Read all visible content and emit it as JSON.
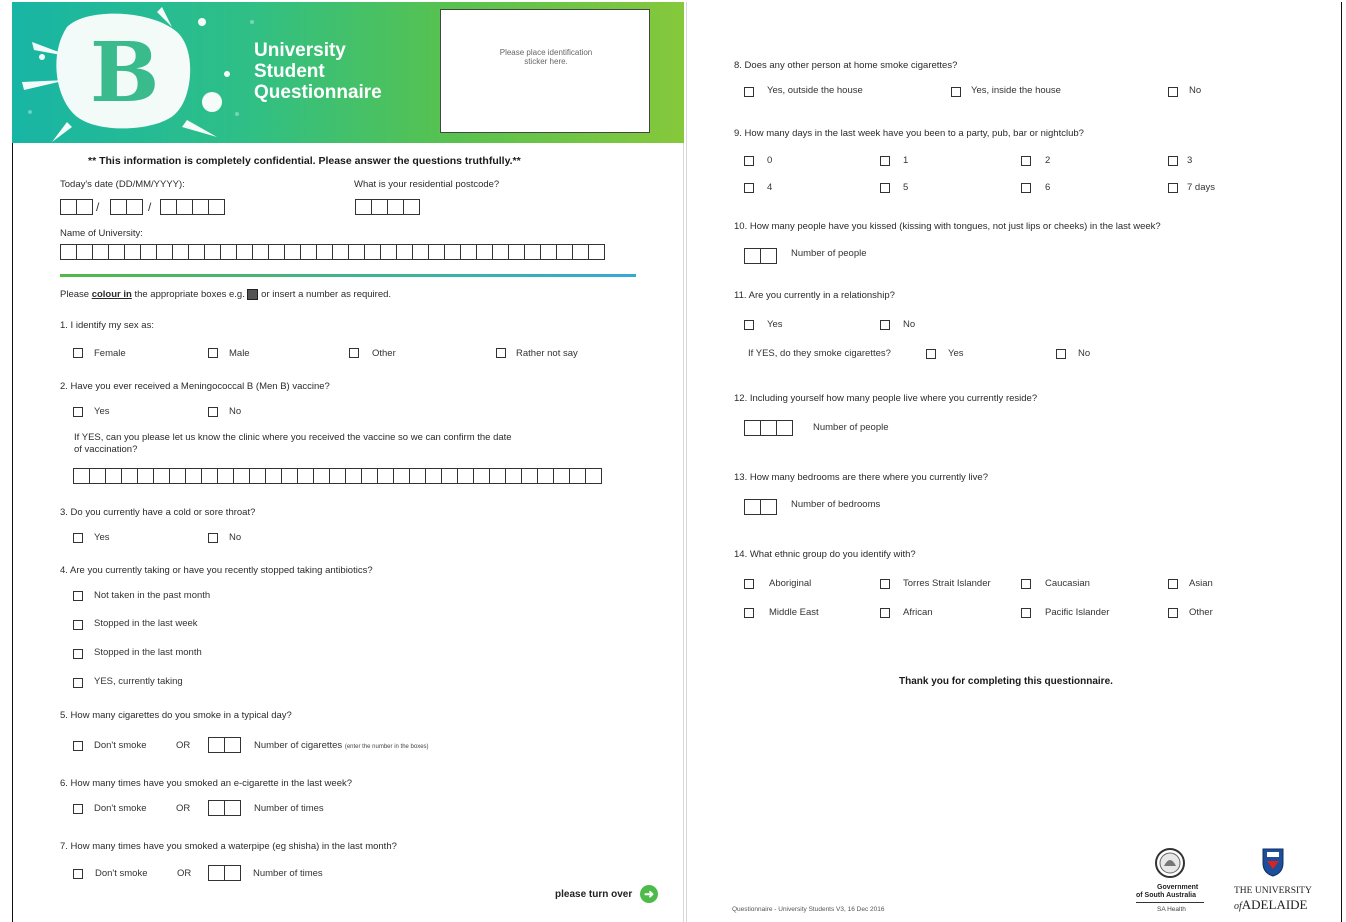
{
  "header": {
    "title_line1": "University",
    "title_line2": "Student",
    "title_line3": "Questionnaire",
    "logo_letter": "B",
    "sticker_text": "Please place identification sticker here."
  },
  "confidential": "** This information is completely confidential. Please answer the questions truthfully.**",
  "fields": {
    "date_label": "Today's date (DD/MM/YYYY):",
    "postcode_label": "What is your residential postcode?",
    "university_label": "Name of University:"
  },
  "instructions": {
    "prefix": "Please ",
    "emph": "colour in",
    "middle": " the appropriate boxes e.g. ",
    "suffix": " or insert a number as required."
  },
  "q1": {
    "text": "1.  I identify my sex as:",
    "options": [
      "Female",
      "Male",
      "Other",
      "Rather not say"
    ]
  },
  "q2": {
    "text": "2.  Have you ever received a Meningococcal B (Men B) vaccine?",
    "options": [
      "Yes",
      "No"
    ],
    "followup": "If YES, can you please let us know the clinic where you received the vaccine so we can confirm the date",
    "followup2": "of vaccination?"
  },
  "q3": {
    "text": "3.  Do you currently have a cold or sore throat?",
    "options": [
      "Yes",
      "No"
    ]
  },
  "q4": {
    "text": "4.  Are you currently taking or have you recently stopped taking antibiotics?",
    "options": [
      "Not taken in the past month",
      "Stopped in the last week",
      "Stopped in the last month",
      "YES, currently taking"
    ]
  },
  "q5": {
    "text": "5.  How many cigarettes do you smoke in a typical day?",
    "dont_smoke": "Don't smoke",
    "or": "OR",
    "count_label": "Number of cigarettes",
    "count_note": "(enter the number in the boxes)"
  },
  "q6": {
    "text": "6.  How many times have you smoked an e-cigarette in the last week?",
    "dont_smoke": "Don't smoke",
    "or": "OR",
    "count_label": "Number of times"
  },
  "q7": {
    "text": "7.  How many times have you smoked a waterpipe (eg shisha) in the last month?",
    "dont_smoke": "Don't smoke",
    "or": "OR",
    "count_label": "Number of times"
  },
  "turn_over": "please turn over",
  "q8": {
    "text": "8.  Does any other person at home smoke cigarettes?",
    "options": [
      "Yes, outside the house",
      "Yes, inside the house",
      "No"
    ]
  },
  "q9": {
    "text": "9.  How many days in the last week have you been to a party, pub, bar or nightclub?",
    "options": [
      "0",
      "1",
      "2",
      "3",
      "4",
      "5",
      "6",
      "7 days"
    ]
  },
  "q10": {
    "text": "10. How many people have you kissed (kissing with tongues, not just lips or cheeks) in the last week?",
    "count_label": "Number of people"
  },
  "q11": {
    "text": "11.  Are you currently in a relationship?",
    "options": [
      "Yes",
      "No"
    ],
    "followup": "If YES, do they smoke cigarettes?",
    "followup_options": [
      "Yes",
      "No"
    ]
  },
  "q12": {
    "text": "12. Including yourself how many people live where you currently reside?",
    "count_label": "Number of people"
  },
  "q13": {
    "text": "13. How many bedrooms are there where you currently live?",
    "count_label": "Number of bedrooms"
  },
  "q14": {
    "text": "14. What ethnic group do you identify with?",
    "options": [
      "Aboriginal",
      "Torres Strait Islander",
      "Caucasian",
      "Asian",
      "Middle East",
      "African",
      "Pacific Islander",
      "Other"
    ]
  },
  "thanks": "Thank you for completing this questionnaire.",
  "footer": {
    "version": "Questionnaire - University Students V3, 16 Dec 2016",
    "gov_line1": "Government",
    "gov_line2": "of South Australia",
    "gov_line3": "SA Health",
    "uni_line1": "THE UNIVERSITY",
    "uni_line2_italic": "of",
    "uni_line2": "ADELAIDE"
  },
  "colors": {
    "banner_start": "#18b5a5",
    "banner_end": "#86c83b",
    "accent_green": "#4dbb4a",
    "rule_blue": "#35a8d8"
  }
}
